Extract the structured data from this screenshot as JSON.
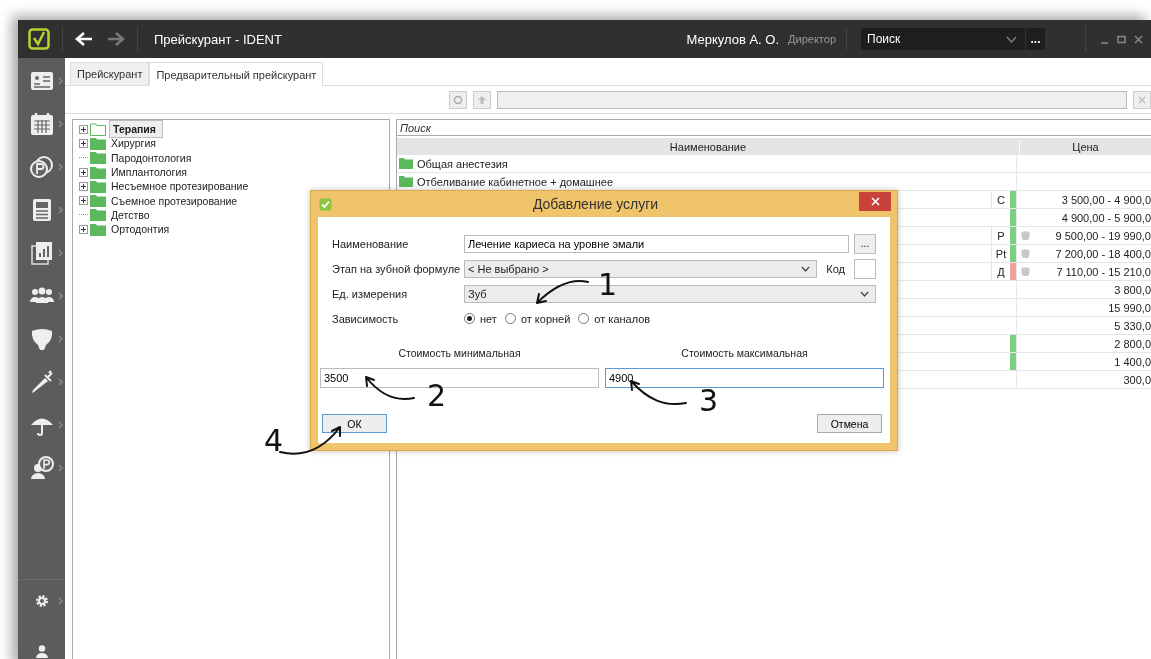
{
  "title_bar": {
    "title": "Прейскурант  - IDENT",
    "user": "Меркулов А. О.",
    "role": "Директор",
    "search": {
      "value": "Поиск"
    },
    "more_button": "..."
  },
  "tabs": [
    {
      "label": "Прейскурант",
      "selected": false
    },
    {
      "label": "Предварительный прейскурант",
      "selected": true
    }
  ],
  "tree": {
    "items": [
      {
        "label": "Терапия",
        "expandable": true,
        "selected": true
      },
      {
        "label": "Хирургия",
        "expandable": true,
        "selected": false
      },
      {
        "label": "Пародонтология",
        "expandable": false,
        "selected": false
      },
      {
        "label": "Имплантология",
        "expandable": true,
        "selected": false
      },
      {
        "label": "Несъемное протезирование",
        "expandable": true,
        "selected": false
      },
      {
        "label": "Съемное протезирование",
        "expandable": true,
        "selected": false
      },
      {
        "label": "Детство",
        "expandable": false,
        "selected": false
      },
      {
        "label": "Ортодонтия",
        "expandable": true,
        "selected": false
      }
    ]
  },
  "grid": {
    "search_placeholder": "Поиск",
    "columns": [
      "Наименование",
      "Цена"
    ],
    "rows": [
      {
        "kind": "folder",
        "name": "Общая анестезия"
      },
      {
        "kind": "folder",
        "name": "Отбеливание кабинетное + домашнее"
      },
      {
        "kind": "service",
        "mark": "С",
        "color": "#7dcf80",
        "tooth": false,
        "price": "3 500,00 - 4 900,0"
      },
      {
        "kind": "service",
        "color": "#7dcf80",
        "tooth": false,
        "price": "4 900,00 - 5 900,0"
      },
      {
        "kind": "service",
        "mark": "P",
        "color": "#7dcf80",
        "tooth": true,
        "price": "9 500,00 - 19 990,0"
      },
      {
        "kind": "service",
        "mark": "Pt",
        "color": "#7dcf80",
        "tooth": true,
        "price": "7 200,00 - 18 400,0"
      },
      {
        "kind": "service",
        "mark": "Д",
        "color": "#f4a09c",
        "tooth": true,
        "price": "7 110,00 - 15 210,0"
      },
      {
        "kind": "service",
        "tooth": false,
        "price": "3 800,0"
      },
      {
        "kind": "service",
        "tooth": false,
        "price": "15 990,0"
      },
      {
        "kind": "service",
        "tooth": false,
        "price": "5 330,0"
      },
      {
        "kind": "service",
        "color": "#7dcf80",
        "tooth": false,
        "price": "2 800,0"
      },
      {
        "kind": "service",
        "color": "#7dcf80",
        "tooth": false,
        "price": "1 400,0"
      },
      {
        "kind": "service",
        "tooth": false,
        "price": "300,0"
      }
    ]
  },
  "dialog": {
    "title": "Добавление услуги",
    "name": {
      "label": "Наименование",
      "value": "Лечение кариеса на уровне эмали",
      "button": "..."
    },
    "stage": {
      "label": "Этап на зубной формуле",
      "value": "< Не выбрано >",
      "code_label": "Код"
    },
    "unit": {
      "label": "Ед. измерения",
      "value": "Зуб"
    },
    "dependency": {
      "label": "Зависимость",
      "options": [
        {
          "label": "нет",
          "selected": true
        },
        {
          "label": "от корней",
          "selected": false
        },
        {
          "label": "от каналов",
          "selected": false
        }
      ]
    },
    "min_cost": {
      "label": "Стоимость минимальная",
      "value": "3500",
      "focused": false
    },
    "max_cost": {
      "label": "Стоимость максимальная",
      "value": "4900",
      "focused": true
    },
    "ok_button": "ОК",
    "cancel_button": "Отмена"
  },
  "annotations": [
    "1",
    "2",
    "3",
    "4"
  ]
}
